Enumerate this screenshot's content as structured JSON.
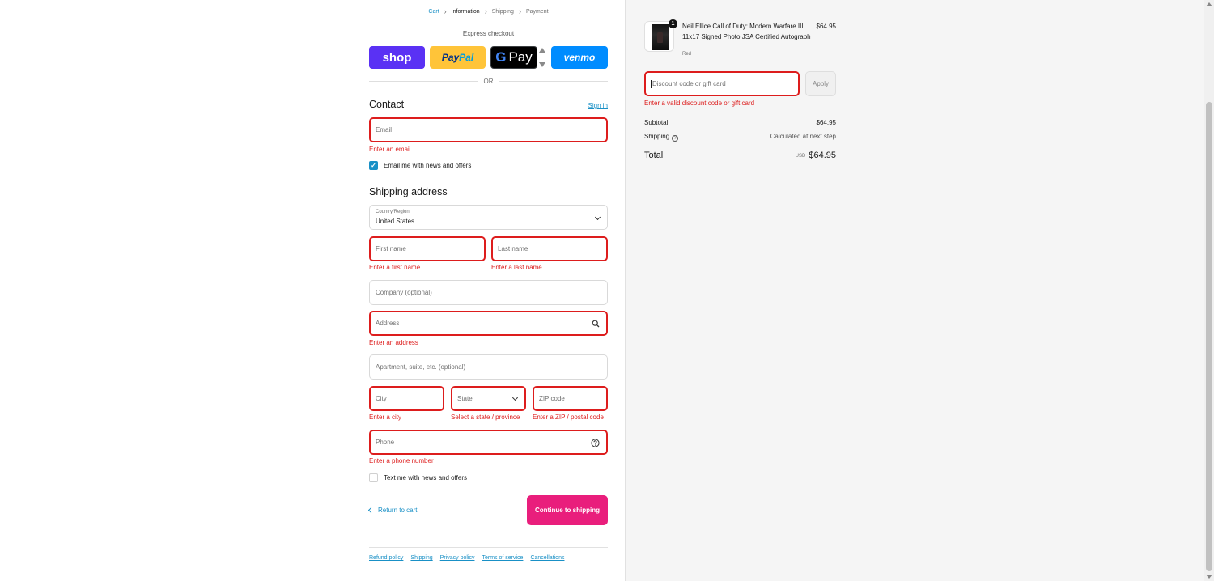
{
  "breadcrumb": {
    "cart": "Cart",
    "information": "Information",
    "shipping": "Shipping",
    "payment": "Payment"
  },
  "express": {
    "title": "Express checkout",
    "shop": "shop",
    "paypal_a": "Pay",
    "paypal_b": "Pal",
    "gpay_g": "G",
    "gpay_text": "Pay",
    "venmo": "venmo",
    "or": "OR"
  },
  "contact": {
    "title": "Contact",
    "signin": "Sign in",
    "email_placeholder": "Email",
    "email_error": "Enter an email",
    "newsletter_label": "Email me with news and offers",
    "newsletter_checked": true
  },
  "shipping": {
    "title": "Shipping address",
    "country_label": "Country/Region",
    "country_value": "United States",
    "first_name": "First name",
    "first_name_error": "Enter a first name",
    "last_name": "Last name",
    "last_name_error": "Enter a last name",
    "company": "Company (optional)",
    "address": "Address",
    "address_error": "Enter an address",
    "apartment": "Apartment, suite, etc. (optional)",
    "city": "City",
    "city_error": "Enter a city",
    "state": "State",
    "state_error": "Select a state / province",
    "zip": "ZIP code",
    "zip_error": "Enter a ZIP / postal code",
    "phone": "Phone",
    "phone_error": "Enter a phone number",
    "sms_label": "Text me with news and offers",
    "sms_checked": false
  },
  "actions": {
    "return": "Return to cart",
    "continue": "Continue to shipping"
  },
  "footer": {
    "links": [
      "Refund policy",
      "Shipping",
      "Privacy policy",
      "Terms of service",
      "Cancellations"
    ]
  },
  "summary": {
    "product": {
      "name": "Neil Ellice Call of Duty: Modern Warfare III 11x17 Signed Photo JSA Certified Autograph",
      "variant": "Red",
      "price": "$64.95",
      "quantity": "1"
    },
    "discount_placeholder": "Discount code or gift card",
    "apply": "Apply",
    "discount_error": "Enter a valid discount code or gift card",
    "subtotal_label": "Subtotal",
    "subtotal_value": "$64.95",
    "shipping_label": "Shipping",
    "shipping_value": "Calculated at next step",
    "total_label": "Total",
    "total_currency": "USD",
    "total_value": "$64.95"
  },
  "colors": {
    "accent": "#1990c6",
    "error": "#dd1d1d",
    "continue_button": "#e91e7c",
    "shop_pay": "#5a31f4",
    "paypal": "#ffc439",
    "venmo": "#008cff"
  }
}
